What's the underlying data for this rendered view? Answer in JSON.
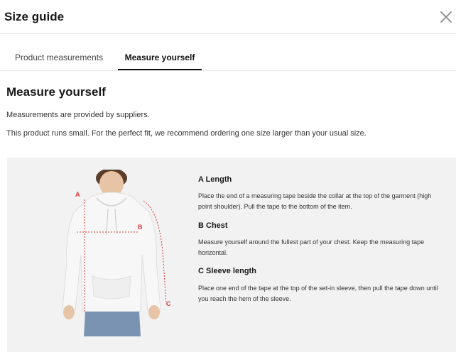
{
  "dialog": {
    "title": "Size guide"
  },
  "tabs": [
    {
      "label": "Product measurements",
      "active": false
    },
    {
      "label": "Measure yourself",
      "active": true
    }
  ],
  "content": {
    "heading": "Measure yourself",
    "note_1": "Measurements are provided by suppliers.",
    "note_2": "This product runs small. For the perfect fit, we recommend ordering one size larger than your usual size."
  },
  "figure": {
    "label_a": "A",
    "label_b": "B",
    "label_c": "C",
    "marker_color": "#e03b3b",
    "garment": "hoodie"
  },
  "measurements": [
    {
      "title": "A Length",
      "text": "Place the end of a measuring tape beside the collar at the top of the garment (high point shoulder). Pull the tape to the bottom of the item."
    },
    {
      "title": "B Chest",
      "text": "Measure yourself around the fullest part of your chest. Keep the measuring tape horizontal."
    },
    {
      "title": "C Sleeve length",
      "text": "Place one end of the tape at the top of the set-in sleeve, then pull the tape down until you reach the hem of the sleeve."
    }
  ],
  "icons": {
    "close": "close-icon"
  }
}
